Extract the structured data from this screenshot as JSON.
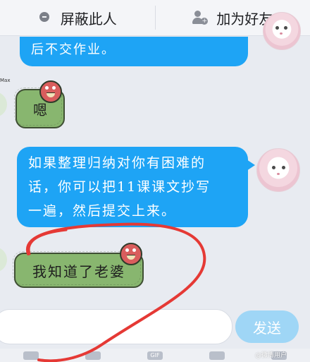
{
  "header": {
    "block_label": "屏蔽此人",
    "add_friend_label": "加为好友"
  },
  "messages": [
    {
      "id": "msg1",
      "side": "right",
      "text": "后不交作业。"
    },
    {
      "id": "msg2",
      "side": "left",
      "sender_label": "Max",
      "sticker_text": "嗯"
    },
    {
      "id": "msg3",
      "side": "right",
      "text_lines": [
        "如果整理归纳对你有困难的",
        "话，你可以把11课课文抄写",
        "一遍，然后提交上来。"
      ]
    },
    {
      "id": "msg4",
      "side": "left",
      "sticker_text": "我知道了老婆"
    }
  ],
  "composer": {
    "send_label": "发送"
  },
  "toolbar": {
    "gif_label": "GIF"
  },
  "watermark": {
    "text": "@微博用户"
  },
  "colors": {
    "blue_bubble": "#1ea4f5",
    "green_sticker": "#88b66f",
    "send_button": "#9fd6f6",
    "annotation_red": "#e53935"
  }
}
